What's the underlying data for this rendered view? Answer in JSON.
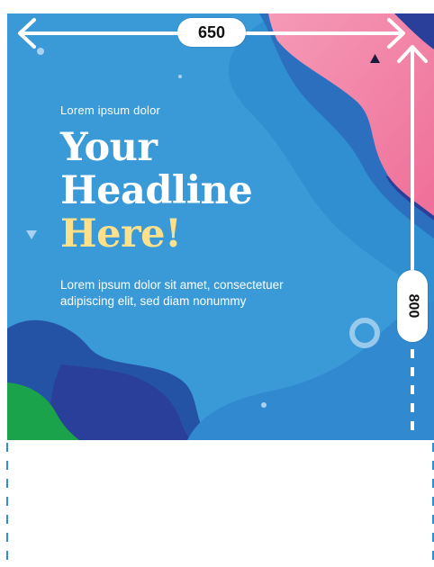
{
  "canvas": {
    "width_label": "650",
    "height_label": "800"
  },
  "design": {
    "kicker": "Lorem ipsum dolor",
    "headline_line1": "Your",
    "headline_line2": "Headline",
    "headline_line3": "Here!",
    "body_line1": "Lorem ipsum dolor sit amet, consectetuer",
    "body_line2": "adipiscing elit, sed diam nonummy"
  },
  "colors": {
    "background_blue": "#2f8fd0",
    "light_blue": "#3ba0dc",
    "deep_blue": "#2453a6",
    "navy": "#2a3f9a",
    "pink": "#f07ca4",
    "green": "#1aa34a",
    "headline_accent": "#ffe08a",
    "text": "#ffffff"
  }
}
